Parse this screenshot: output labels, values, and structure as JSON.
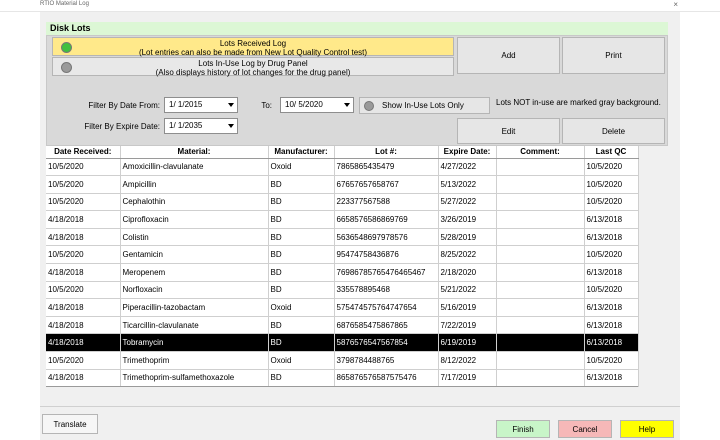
{
  "window": {
    "title": "RTIO Material Log",
    "close_glyph": "×"
  },
  "section": {
    "title": "Disk Lots"
  },
  "options": {
    "received": {
      "line1": "Lots Received Log",
      "line2": "(Lot entries can also be made from New Lot Quality Control test)",
      "color": "#ffe98a",
      "led_color": "#40c040"
    },
    "inuse": {
      "line1": "Lots In-Use Log by Drug Panel",
      "line2": "(Also displays history of lot changes for the drug panel)",
      "color": "#e8e8e8",
      "led_color": "#9a9a9a"
    }
  },
  "buttons": {
    "add": "Add",
    "print": "Print",
    "edit": "Edit",
    "delete": "Delete",
    "show_inuse": "Show In-Use Lots Only",
    "translate": "Translate",
    "finish": "Finish",
    "cancel": "Cancel",
    "help": "Help"
  },
  "colors": {
    "finish": "#c8f5c8",
    "cancel": "#f6b8b8",
    "help": "#ffff00"
  },
  "filters": {
    "date_from_label": "Filter By Date From:",
    "date_from": "1/ 1/2015",
    "to_label": "To:",
    "date_to": "10/ 5/2020",
    "expire_label": "Filter By Expire Date:",
    "expire_date": "1/ 1/2035"
  },
  "note": "Lots NOT in-use are marked gray background.",
  "table": {
    "columns": [
      "Date Received:",
      "Material:",
      "Manufacturer:",
      "Lot #:",
      "Expire Date:",
      "Comment:",
      "Last QC"
    ],
    "rows": [
      [
        "10/5/2020",
        "Amoxicillin-clavulanate",
        "Oxoid",
        "7865865435479",
        "4/27/2022",
        "",
        "10/5/2020"
      ],
      [
        "10/5/2020",
        "Ampicillin",
        "BD",
        "67657657658767",
        "5/13/2022",
        "",
        "10/5/2020"
      ],
      [
        "10/5/2020",
        "Cephalothin",
        "BD",
        "223377567588",
        "5/27/2022",
        "",
        "10/5/2020"
      ],
      [
        "4/18/2018",
        "Ciprofloxacin",
        "BD",
        "6658576586869769",
        "3/26/2019",
        "",
        "6/13/2018"
      ],
      [
        "4/18/2018",
        "Colistin",
        "BD",
        "5636548697978576",
        "5/28/2019",
        "",
        "6/13/2018"
      ],
      [
        "10/5/2020",
        "Gentamicin",
        "BD",
        "95474758436876",
        "8/25/2022",
        "",
        "10/5/2020"
      ],
      [
        "4/18/2018",
        "Meropenem",
        "BD",
        "76986785765476465467",
        "2/18/2020",
        "",
        "6/13/2018"
      ],
      [
        "10/5/2020",
        "Norfloxacin",
        "BD",
        "335578895468",
        "5/21/2022",
        "",
        "10/5/2020"
      ],
      [
        "4/18/2018",
        "Piperacillin-tazobactam",
        "Oxoid",
        "575474575764747654",
        "5/16/2019",
        "",
        "6/13/2018"
      ],
      [
        "4/18/2018",
        "Ticarcillin-clavulanate",
        "BD",
        "6876585475867865",
        "7/22/2019",
        "",
        "6/13/2018"
      ],
      [
        "4/18/2018",
        "Tobramycin",
        "BD",
        "5876576547567854",
        "6/19/2019",
        "",
        "6/13/2018"
      ],
      [
        "10/5/2020",
        "Trimethoprim",
        "Oxoid",
        "3798784488765",
        "8/12/2022",
        "",
        "10/5/2020"
      ],
      [
        "4/18/2018",
        "Trimethoprim-sulfamethoxazole",
        "BD",
        "865876576587575476",
        "7/17/2019",
        "",
        "6/13/2018"
      ]
    ],
    "selected_row": 10
  }
}
